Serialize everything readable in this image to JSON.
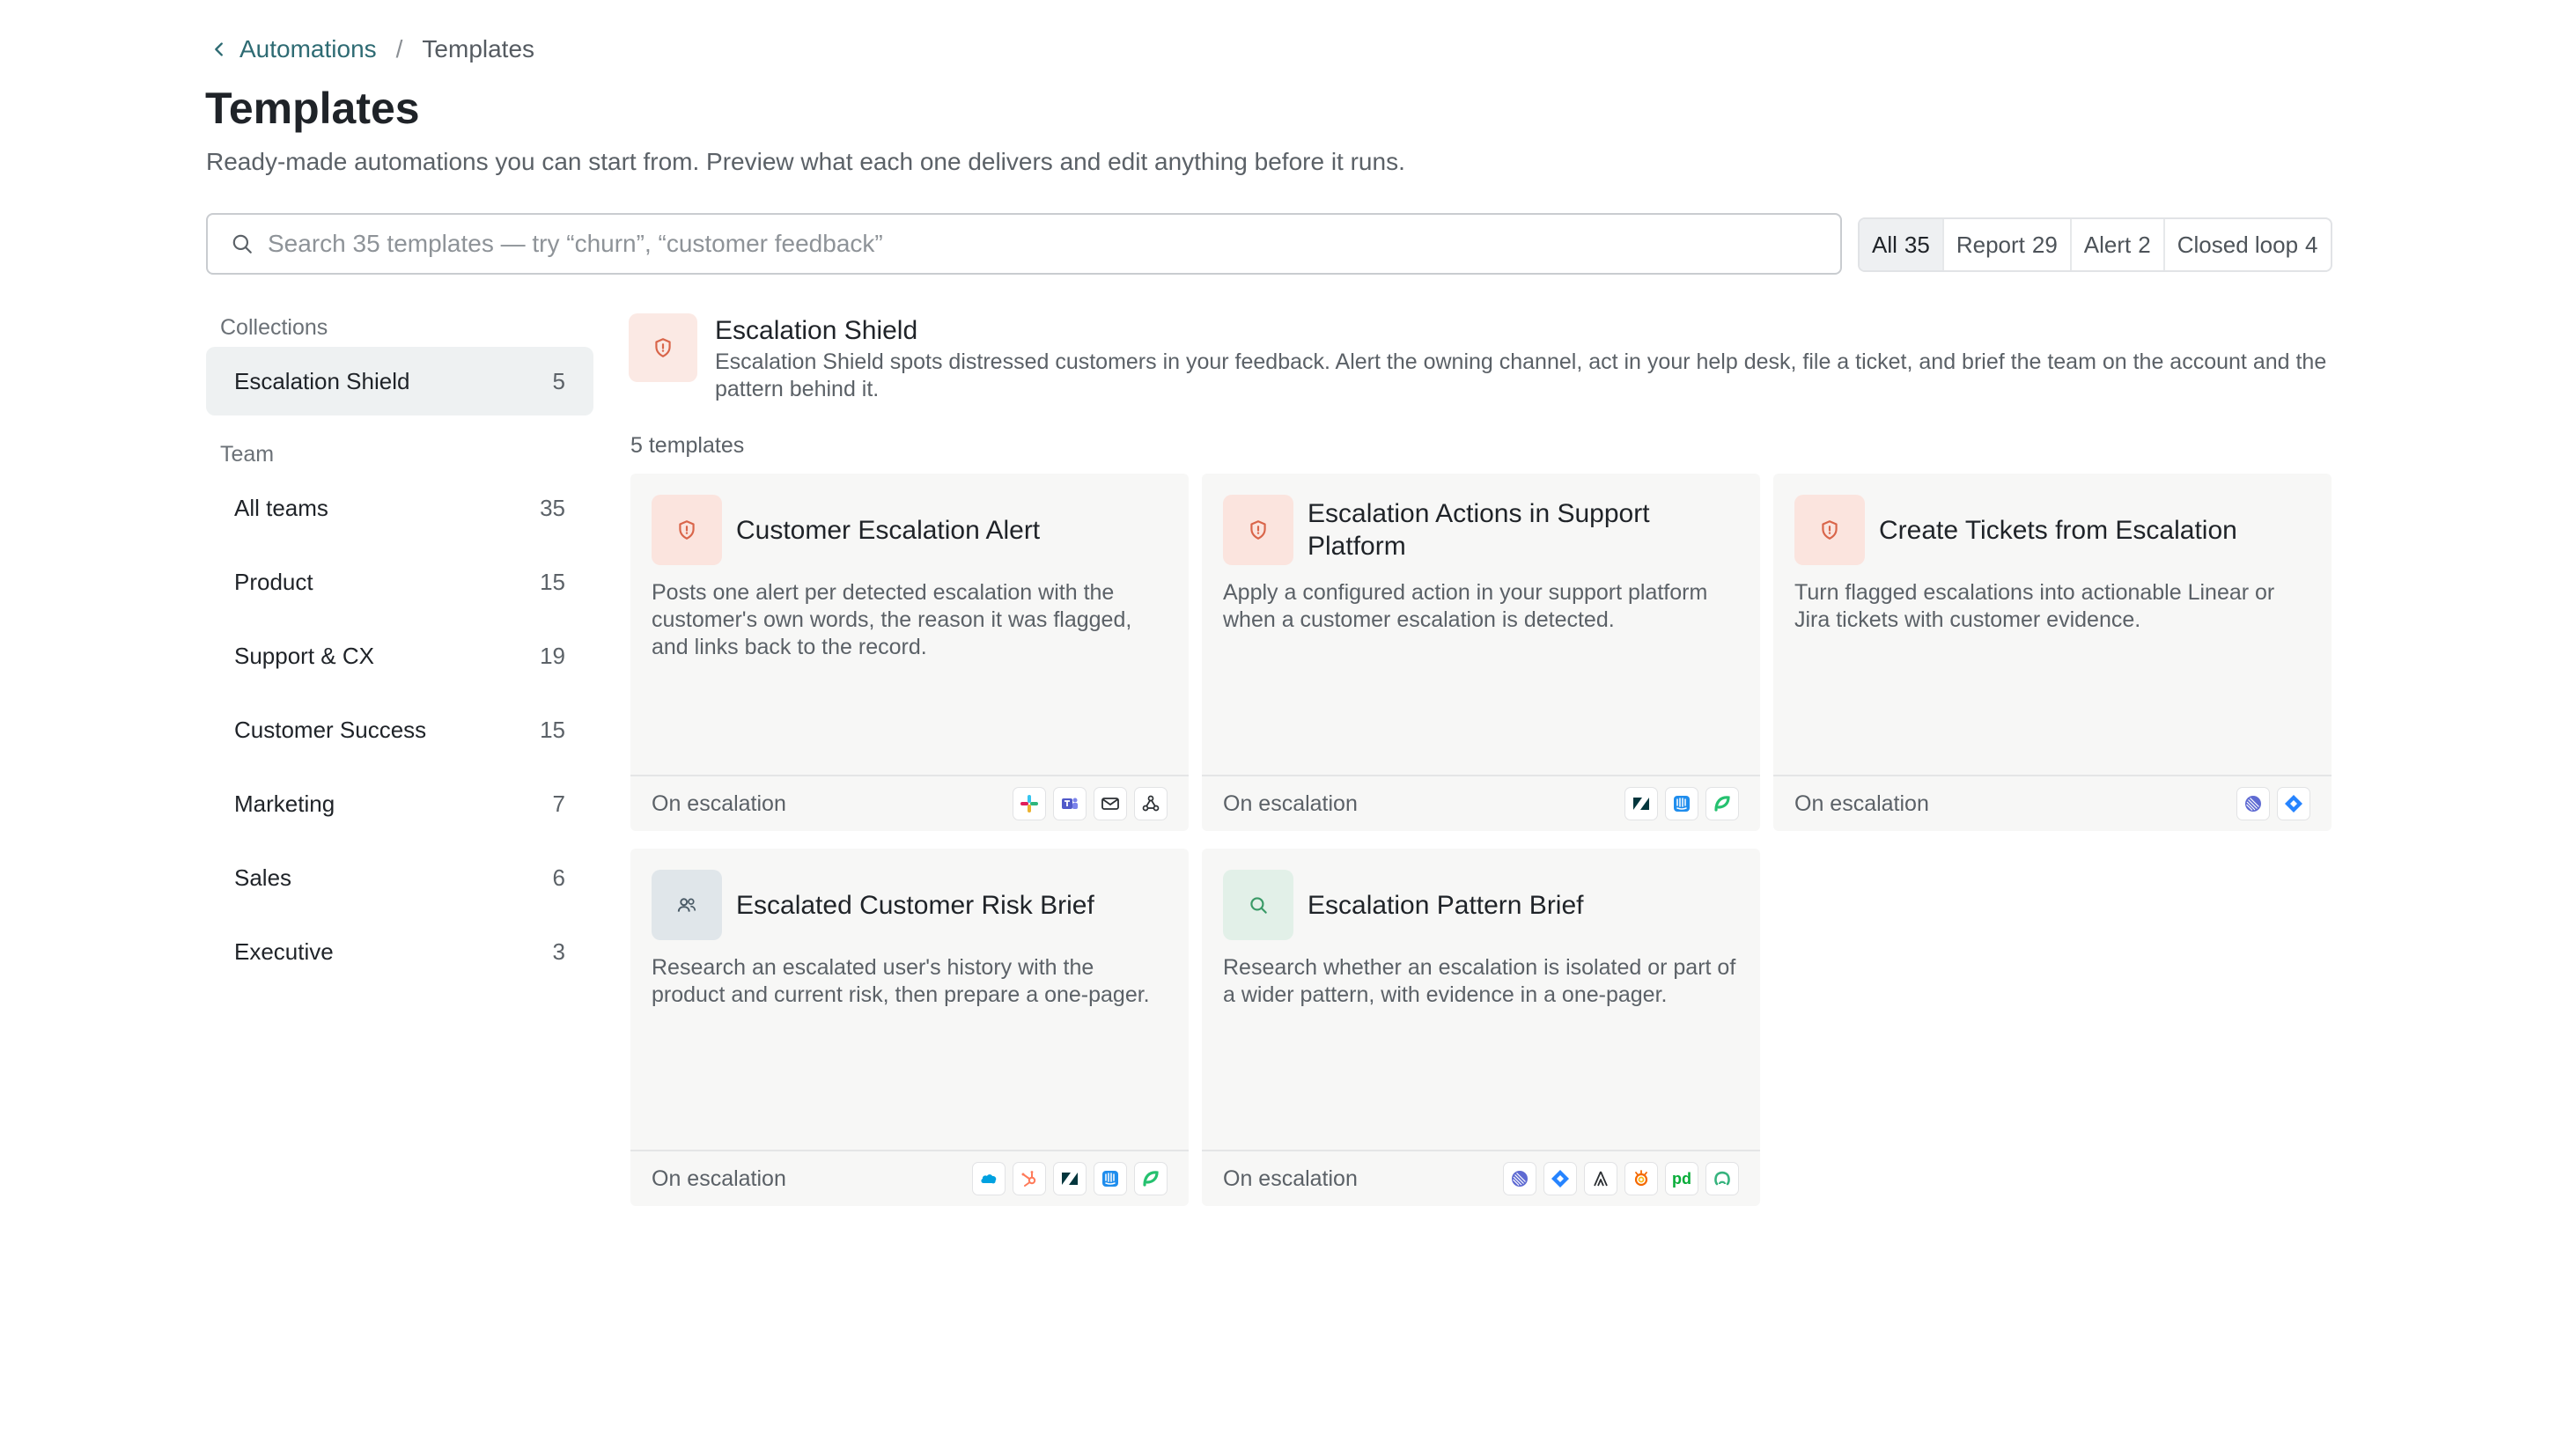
{
  "breadcrumb": {
    "parent": "Automations",
    "separator": "/",
    "current": "Templates"
  },
  "page": {
    "title": "Templates",
    "description": "Ready-made automations you can start from. Preview what each one delivers and edit anything before it runs."
  },
  "search": {
    "placeholder": "Search 35 templates — try “churn”, “customer feedback”",
    "value": ""
  },
  "filters": [
    {
      "label": "All",
      "count": "35",
      "selected": true
    },
    {
      "label": "Report",
      "count": "29"
    },
    {
      "label": "Alert",
      "count": "2"
    },
    {
      "label": "Closed loop",
      "count": "4"
    }
  ],
  "sidebar": {
    "collections_heading": "Collections",
    "collections": [
      {
        "label": "Escalation Shield",
        "count": "5",
        "active": true
      }
    ],
    "team_heading": "Team",
    "teams": [
      {
        "label": "All teams",
        "count": "35"
      },
      {
        "label": "Product",
        "count": "15"
      },
      {
        "label": "Support & CX",
        "count": "19"
      },
      {
        "label": "Customer Success",
        "count": "15"
      },
      {
        "label": "Marketing",
        "count": "7"
      },
      {
        "label": "Sales",
        "count": "6"
      },
      {
        "label": "Executive",
        "count": "3"
      }
    ]
  },
  "collection": {
    "title": "Escalation Shield",
    "description": "Escalation Shield spots distressed customers in your feedback. Alert the owning channel, act in your help desk, file a ticket, and brief the team on the account and the pattern behind it.",
    "count_label": "5 templates",
    "icon": "shield-icon"
  },
  "templates": [
    {
      "title": "Customer Escalation Alert",
      "description": "Posts one alert per detected escalation with the customer's own words, the reason it was flagged, and links back to the record.",
      "trigger": "On escalation",
      "icon": "shield-icon",
      "integrations": [
        "slack-icon",
        "teams-icon",
        "email-icon",
        "webhook-icon"
      ]
    },
    {
      "title": "Escalation Actions in Support Platform",
      "description": "Apply a configured action in your support platform when a customer escalation is detected.",
      "trigger": "On escalation",
      "icon": "shield-icon",
      "integrations": [
        "zendesk-icon",
        "intercom-icon",
        "freshdesk-icon"
      ]
    },
    {
      "title": "Create Tickets from Escalation",
      "description": "Turn flagged escalations into actionable Linear or Jira tickets with customer evidence.",
      "trigger": "On escalation",
      "icon": "shield-icon",
      "integrations": [
        "linear-icon",
        "jira-icon"
      ]
    },
    {
      "title": "Escalated Customer Risk Brief",
      "description": "Research an escalated user's history with the product and current risk, then prepare a one-pager.",
      "trigger": "On escalation",
      "icon": "users-icon",
      "integrations": [
        "salesforce-icon",
        "hubspot-icon",
        "zendesk-icon",
        "intercom-icon",
        "freshdesk-icon"
      ],
      "integration_labels": {
        "salesforce-icon": "",
        "hubspot-icon": ""
      }
    },
    {
      "title": "Escalation Pattern Brief",
      "description": "Research whether an escalation is isolated or part of a wider pattern, with evidence in a one-pager.",
      "trigger": "On escalation",
      "icon": "search-icon",
      "integrations": [
        "linear-icon",
        "jira-icon",
        "atlassian-icon",
        "grafana-icon",
        "pagerduty-icon",
        "opsgenie-icon"
      ],
      "pagerduty_text": "pd"
    }
  ],
  "colors": {
    "accent_link": "#2e6b73",
    "shield_red": "#d9654a",
    "card_bg": "#f7f7f6"
  }
}
